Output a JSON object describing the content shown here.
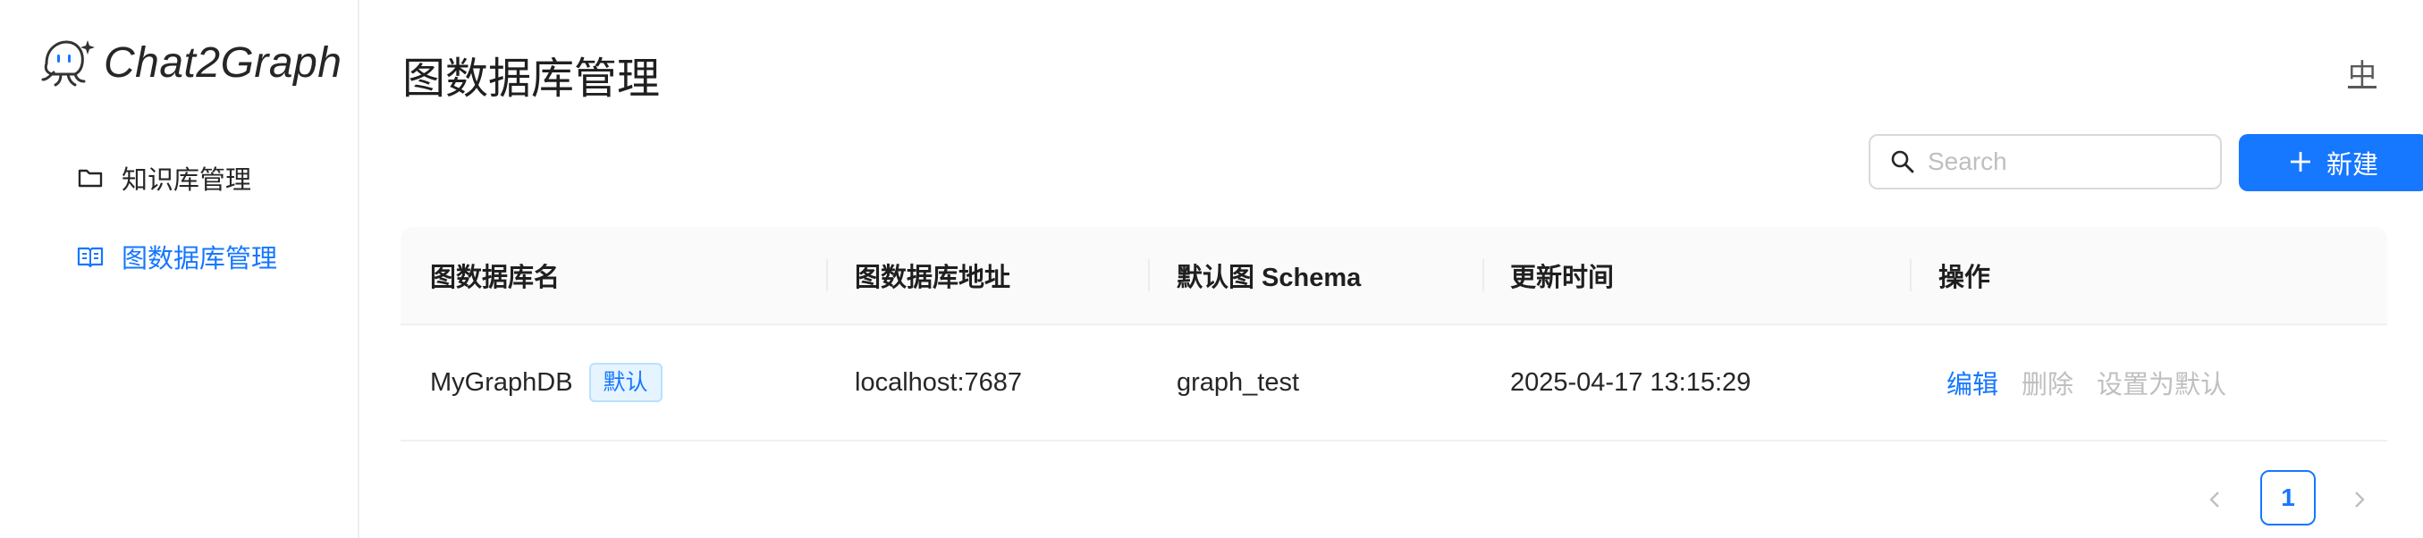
{
  "app": {
    "logo_text": "Chat2Graph",
    "page_title": "图数据库管理",
    "lang_toggle": "中"
  },
  "sidebar": {
    "items": [
      {
        "label": "知识库管理",
        "icon": "folder-icon",
        "active": false
      },
      {
        "label": "图数据库管理",
        "icon": "book-icon",
        "active": true
      }
    ]
  },
  "toolbar": {
    "search_placeholder": "Search",
    "search_value": "",
    "new_label": "新建",
    "new_icon": "plus-icon"
  },
  "table": {
    "columns": [
      "图数据库名",
      "图数据库地址",
      "默认图 Schema",
      "更新时间",
      "操作"
    ],
    "rows": [
      {
        "name": "MyGraphDB",
        "tag": "默认",
        "address": "localhost:7687",
        "schema": "graph_test",
        "updated": "2025-04-17 13:15:29",
        "actions": {
          "edit": "编辑",
          "delete": "删除",
          "set_default": "设置为默认"
        }
      }
    ]
  },
  "pagination": {
    "current_page": "1"
  },
  "colors": {
    "accent": "#1677ff",
    "disabled": "#bfbfbf",
    "header_bg": "#fafafa"
  }
}
